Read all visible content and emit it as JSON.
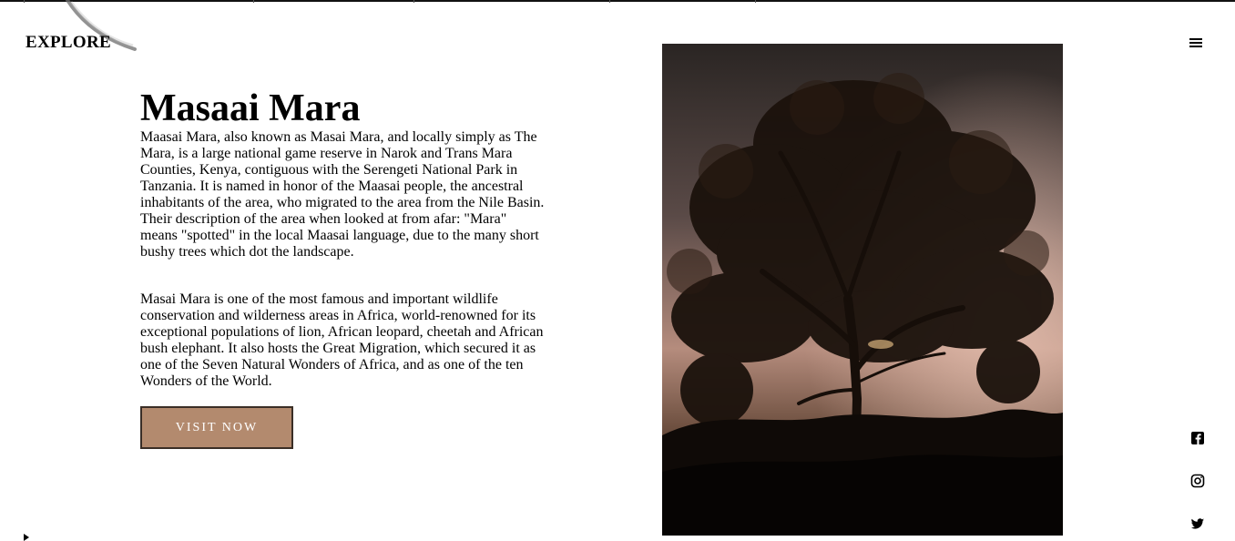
{
  "header": {
    "brand": "EXPLORE"
  },
  "hero": {
    "title": "Masaai Mara",
    "paragraph_1": "Maasai Mara, also known as Masai Mara, and locally simply as The Mara, is a large national game reserve in Narok and Trans Mara Counties, Kenya, contiguous with the Serengeti National Park in Tanzania. It is named in honor of the Maasai people, the ancestral inhabitants of the area, who migrated to the area from the Nile Basin. Their description of the area when looked at from afar: \"Mara\" means \"spotted\" in the local Maasai language, due to the many short bushy trees which dot the landscape.",
    "paragraph_2": "Masai Mara is one of the most famous and important wildlife conservation and wilderness areas in Africa, world-renowned for its exceptional populations of lion, African leopard, cheetah and African bush elephant. It also hosts the Great Migration, which secured it as one of the Seven Natural Wonders of Africa, and as one of the ten Wonders of the World.",
    "cta_label": "VISIT NOW"
  },
  "icons": {
    "menu": "hamburger-menu-icon",
    "social": [
      "facebook-icon",
      "instagram-icon",
      "twitter-icon"
    ]
  },
  "colors": {
    "accent": "#b38a6e",
    "button_border": "#3a2e26"
  }
}
